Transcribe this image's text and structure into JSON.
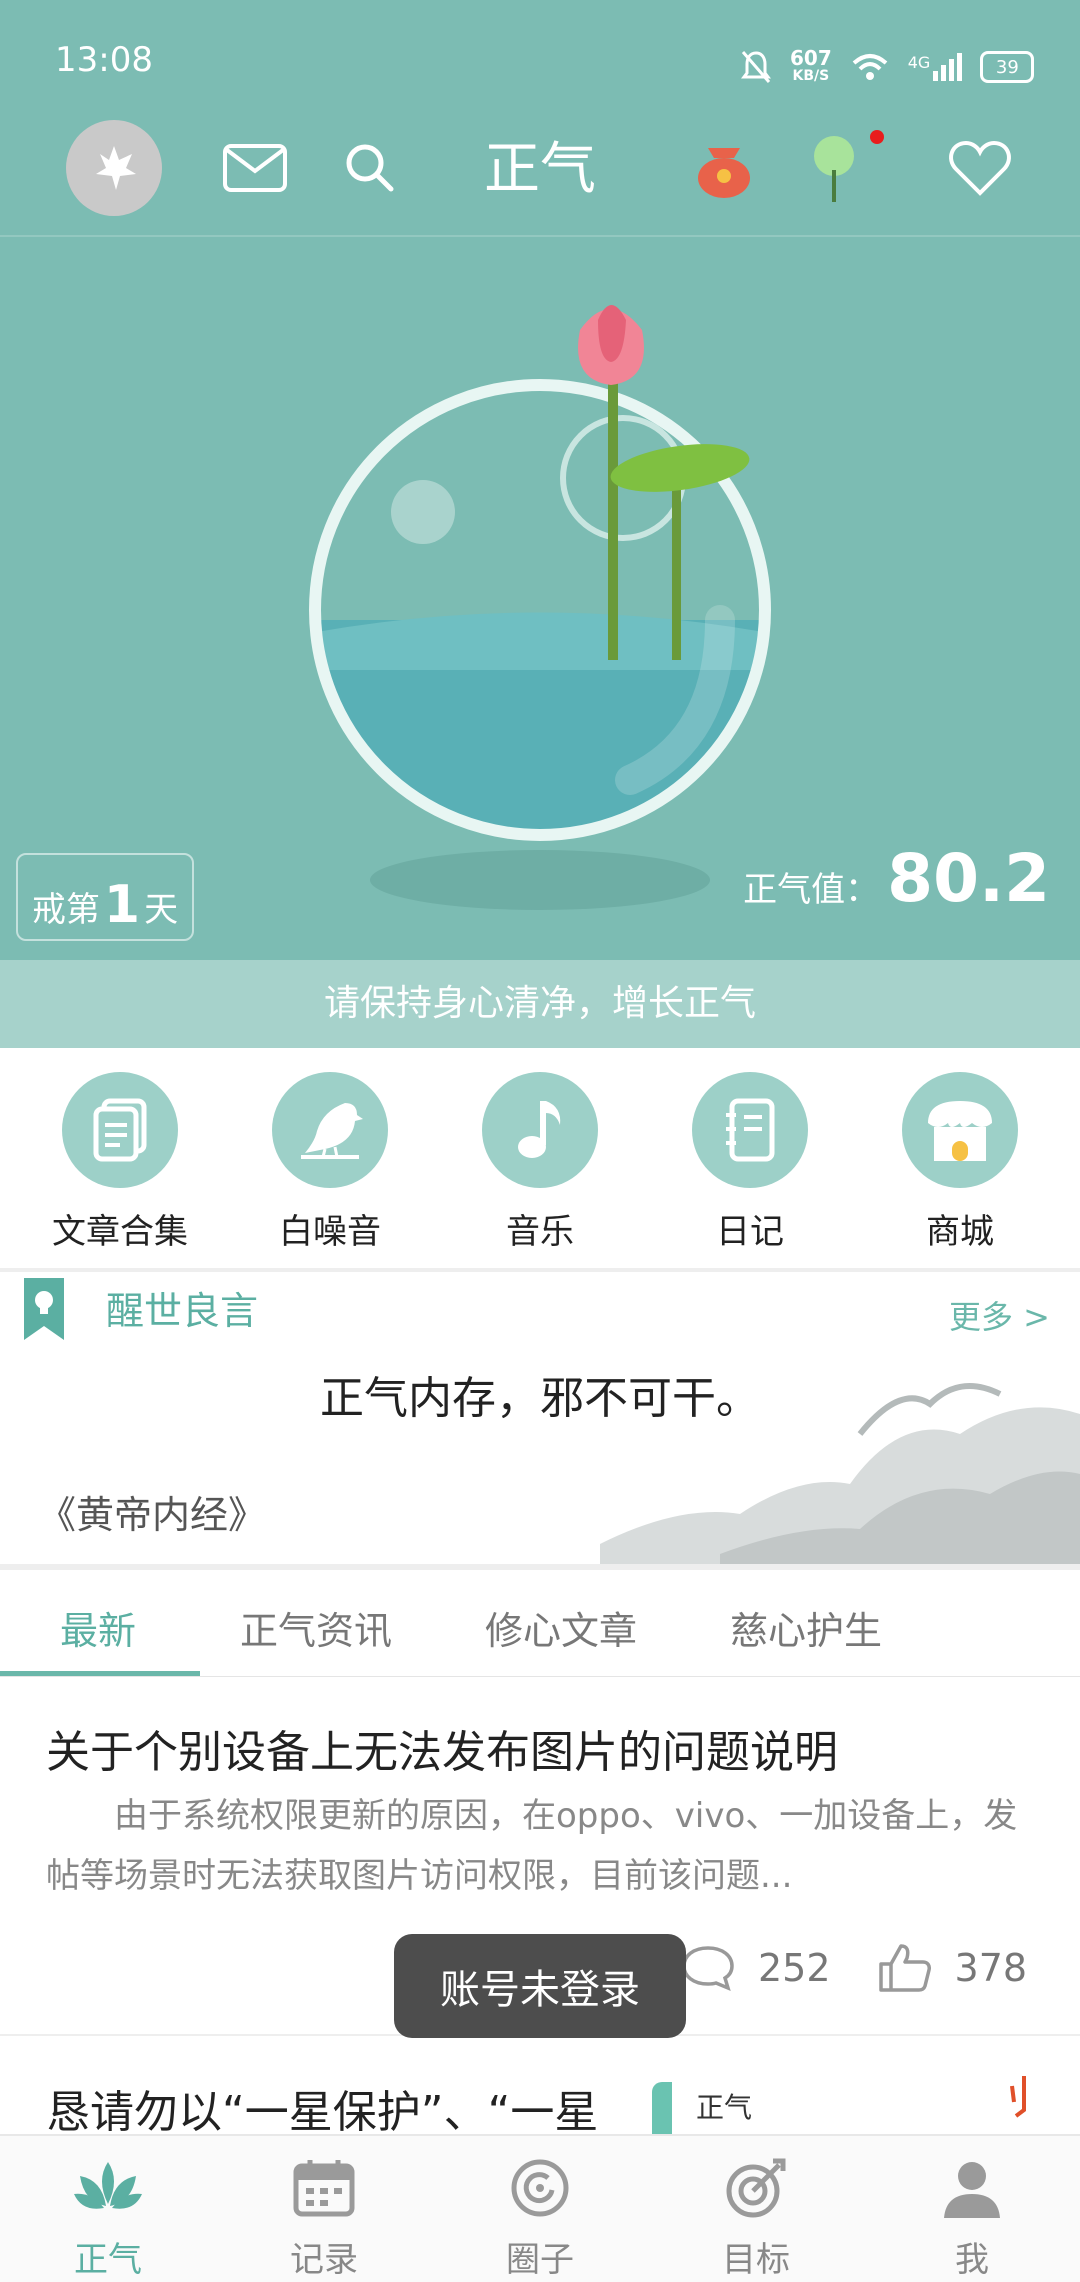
{
  "status": {
    "time": "13:08",
    "net_speed": "607",
    "net_unit": "KB/S",
    "network": "4G",
    "battery": "39"
  },
  "header": {
    "title": "正气",
    "icons": [
      "avatar-icon",
      "mail-icon",
      "search-icon",
      "gift-bag-icon",
      "tree-icon",
      "heart-icon"
    ]
  },
  "hero": {
    "days_prefix": "戒第",
    "days_count": "1",
    "days_suffix": "天",
    "score_label": "正气值：",
    "score_value": "80.2",
    "motto": "请保持身心清净，增长正气"
  },
  "functions": [
    {
      "label": "文章合集",
      "icon": "document-icon"
    },
    {
      "label": "白噪音",
      "icon": "bird-icon"
    },
    {
      "label": "音乐",
      "icon": "music-note-icon"
    },
    {
      "label": "日记",
      "icon": "notebook-icon"
    },
    {
      "label": "商城",
      "icon": "shop-icon"
    }
  ],
  "quote": {
    "title": "醒世良言",
    "more": "更多 >",
    "text": "正气内存，邪不可干。",
    "source": "《黄帝内经》"
  },
  "tabs": [
    "最新",
    "正气资讯",
    "修心文章",
    "慈心护生"
  ],
  "articles": [
    {
      "title": "关于个别设备上无法发布图片的问题说明",
      "excerpt": "　　由于系统权限更新的原因，在oppo、vivo、一加设备上，发帖等场景时无法获取图片访问权限，目前该问题...",
      "comments": "252",
      "likes": "378"
    },
    {
      "title": "恳请勿以“一星保护”、“一星",
      "badge": "正气"
    }
  ],
  "toast": "账号未登录",
  "bottom_nav": [
    {
      "label": "正气",
      "icon": "lotus-icon",
      "active": true
    },
    {
      "label": "记录",
      "icon": "calendar-icon"
    },
    {
      "label": "圈子",
      "icon": "circle-icon"
    },
    {
      "label": "目标",
      "icon": "target-icon"
    },
    {
      "label": "我",
      "icon": "profile-icon"
    }
  ],
  "colors": {
    "primary": "#7cbcb3",
    "accent": "#5bafa2",
    "toast_bg": "#4d4d4d"
  }
}
